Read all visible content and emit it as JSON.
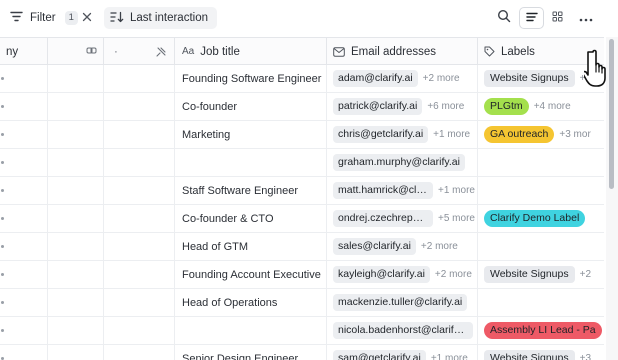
{
  "toolbar": {
    "filter_label": "Filter",
    "filter_count": "1",
    "sort_label": "Last interaction"
  },
  "columns": {
    "company": "ny",
    "job_title": "Job title",
    "emails": "Email addresses",
    "labels": "Labels"
  },
  "rows": [
    {
      "job": "Founding Software Engineer",
      "email": "adam@clarify.ai",
      "email_more": "+2 more",
      "label": "Website Signups",
      "label_more": "+1",
      "label_color": "#e8eaee",
      "label_text_color": "#1f2328"
    },
    {
      "job": "Co-founder",
      "email": "patrick@clarify.ai",
      "email_more": "+6 more",
      "label": "PLGtm",
      "label_more": "+4 more",
      "label_color": "#a4e04d",
      "label_text_color": "#1f2328"
    },
    {
      "job": "Marketing",
      "email": "chris@getclarify.ai",
      "email_more": "+1 more",
      "label": "GA outreach",
      "label_more": "+3 mor",
      "label_color": "#f5c531",
      "label_text_color": "#1f2328"
    },
    {
      "job": "",
      "email": "graham.murphy@clarify.ai",
      "email_more": "",
      "label": "",
      "label_more": "",
      "label_color": "",
      "label_text_color": ""
    },
    {
      "job": "Staff Software Engineer",
      "email": "matt.hamrick@clarif...",
      "email_more": "+1 more",
      "label": "",
      "label_more": "",
      "label_color": "",
      "label_text_color": ""
    },
    {
      "job": "Co-founder & CTO",
      "email": "ondrej.czechrep@...",
      "email_more": "+5 more",
      "label": "Clarify Demo Label",
      "label_more": "",
      "label_color": "#3fd3e0",
      "label_text_color": "#1f2328"
    },
    {
      "job": "Head of GTM",
      "email": "sales@clarify.ai",
      "email_more": "+2 more",
      "label": "",
      "label_more": "",
      "label_color": "",
      "label_text_color": ""
    },
    {
      "job": "Founding Account Executive",
      "email": "kayleigh@clarify.ai",
      "email_more": "+2 more",
      "label": "Website Signups",
      "label_more": "+2",
      "label_color": "#e8eaee",
      "label_text_color": "#1f2328"
    },
    {
      "job": "Head of Operations",
      "email": "mackenzie.tuller@clarify.ai",
      "email_more": "",
      "label": "",
      "label_more": "",
      "label_color": "",
      "label_text_color": ""
    },
    {
      "job": "",
      "email": "nicola.badenhorst@clarify.ai",
      "email_more": "",
      "label": "Assembly LI Lead - Pa",
      "label_more": "",
      "label_color": "#ee5a66",
      "label_text_color": "#1f2328"
    },
    {
      "job": "Senior Design Engineer",
      "email": "sam@getclarify.ai",
      "email_more": "+1 more",
      "label": "Website Signups",
      "label_more": "+3",
      "label_color": "#e8eaee",
      "label_text_color": "#1f2328"
    }
  ],
  "icons": {
    "filter": "filter-icon",
    "clear": "close-icon",
    "sort": "sort-icon",
    "search": "search-icon",
    "list_view": "list-view-icon",
    "grid_view": "grid-view-icon",
    "more": "more-horizontal-icon"
  }
}
